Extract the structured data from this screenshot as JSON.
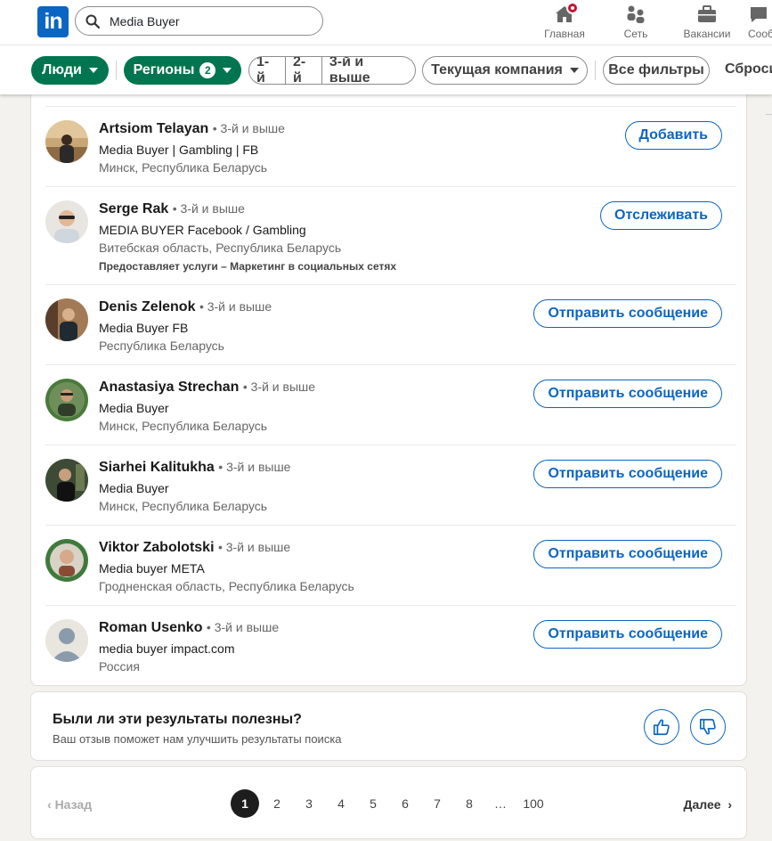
{
  "nav": {
    "logo_text": "in",
    "search_value": "Media Buyer",
    "items": [
      {
        "label": "Главная",
        "icon": "home-icon"
      },
      {
        "label": "Сеть",
        "icon": "network-icon"
      },
      {
        "label": "Вакансии",
        "icon": "jobs-icon"
      },
      {
        "label": "Сооб",
        "icon": "messaging-icon"
      }
    ]
  },
  "filters": {
    "people": "Люди",
    "regions": "Регионы",
    "regions_count": "2",
    "deg1": "1-й",
    "deg2": "2-й",
    "deg3": "3-й и выше",
    "company": "Текущая компания",
    "all_filters": "Все фильтры",
    "reset": "Сбросить"
  },
  "results": [
    {
      "name": "Artsiom Telayan",
      "degree": "• 3-й и выше",
      "headline": "Media Buyer | Gambling | FB",
      "location": "Минск, Республика Беларусь",
      "services": "",
      "action": "Добавить"
    },
    {
      "name": "Serge Rak",
      "degree": "• 3-й и выше",
      "headline": "MEDIA BUYER Facebook / Gambling",
      "location": "Витебская область, Республика Беларусь",
      "services": "Предоставляет услуги – Маркетинг в социальных сетях",
      "action": "Отслеживать"
    },
    {
      "name": "Denis Zelenok",
      "degree": "• 3-й и выше",
      "headline": "Media Buyer FB",
      "location": "Республика Беларусь",
      "services": "",
      "action": "Отправить сообщение"
    },
    {
      "name": "Anastasiya Strechan",
      "degree": "• 3-й и выше",
      "headline": "Media Buyer",
      "location": "Минск, Республика Беларусь",
      "services": "",
      "action": "Отправить сообщение"
    },
    {
      "name": "Siarhei Kalitukha",
      "degree": "• 3-й и выше",
      "headline": "Media Buyer",
      "location": "Минск, Республика Беларусь",
      "services": "",
      "action": "Отправить сообщение"
    },
    {
      "name": "Viktor Zabolotski",
      "degree": "• 3-й и выше",
      "headline": "Media buyer META",
      "location": "Гродненская область, Республика Беларусь",
      "services": "",
      "action": "Отправить сообщение"
    },
    {
      "name": "Roman Usenko",
      "degree": "• 3-й и выше",
      "headline": "media buyer impact.com",
      "location": "Россия",
      "services": "",
      "action": "Отправить сообщение"
    }
  ],
  "feedback": {
    "title": "Были ли эти результаты полезны?",
    "subtitle": "Ваш отзыв поможет нам улучшить результаты поиска"
  },
  "pagination": {
    "prev": "Назад",
    "next": "Далее",
    "pages": [
      "1",
      "2",
      "3",
      "4",
      "5",
      "6",
      "7",
      "8",
      "…",
      "100"
    ],
    "current": "1"
  },
  "colors": {
    "brand": "#0a66c2",
    "filter_active": "#01754f",
    "notification": "#cb112d"
  }
}
